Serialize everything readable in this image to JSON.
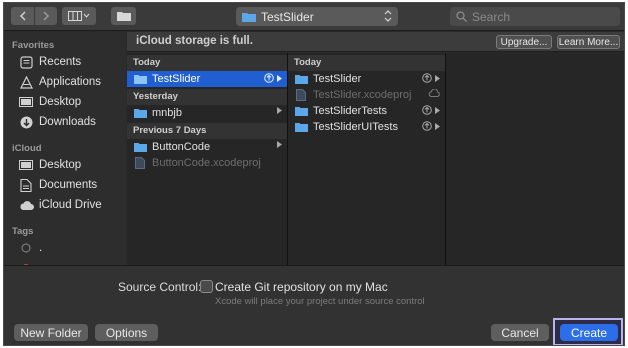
{
  "toolbar": {
    "back_icon": "chevron-left-icon",
    "forward_icon": "chevron-right-icon",
    "view_icon": "column-view-icon",
    "new_folder_icon": "folder-icon",
    "path_location": "TestSlider",
    "search_placeholder": "Search"
  },
  "sidebar": {
    "favorites_title": "Favorites",
    "favorites": [
      {
        "label": "Recents",
        "icon": "clock-icon"
      },
      {
        "label": "Applications",
        "icon": "applications-icon"
      },
      {
        "label": "Desktop",
        "icon": "desktop-icon"
      },
      {
        "label": "Downloads",
        "icon": "downloads-icon"
      }
    ],
    "icloud_title": "iCloud",
    "icloud": [
      {
        "label": "Desktop",
        "icon": "desktop-icon"
      },
      {
        "label": "Documents",
        "icon": "document-icon"
      },
      {
        "label": "iCloud Drive",
        "icon": "cloud-icon"
      }
    ],
    "tags_title": "Tags",
    "tags": [
      {
        "label": ".",
        "icon": "tag-dot-icon"
      }
    ]
  },
  "banner": {
    "message": "iCloud storage is full.",
    "upgrade_label": "Upgrade...",
    "learn_more_label": "Learn More..."
  },
  "column1": {
    "groups": [
      {
        "title": "Today",
        "items": [
          {
            "label": "TestSlider",
            "selected": true
          }
        ]
      },
      {
        "title": "Yesterday",
        "items": [
          {
            "label": "mnbjb",
            "selected": false
          }
        ]
      },
      {
        "title": "Previous 7 Days",
        "items": [
          {
            "label": "ButtonCode",
            "selected": false
          },
          {
            "label": "ButtonCode.xcodeproj",
            "selected": false
          }
        ]
      }
    ]
  },
  "column2": {
    "title": "Today",
    "items": [
      {
        "label": "TestSlider"
      },
      {
        "label": "TestSlider.xcodeproj"
      },
      {
        "label": "TestSliderTests"
      },
      {
        "label": "TestSliderUITests"
      }
    ]
  },
  "bottom": {
    "source_control_label": "Source Control:",
    "git_checkbox_label": "Create Git repository on my Mac",
    "git_checked": false,
    "hint": "Xcode will place your project under source control",
    "new_folder_label": "New Folder",
    "options_label": "Options",
    "cancel_label": "Cancel",
    "create_label": "Create"
  },
  "colors": {
    "selection": "#1f5fd1",
    "create_button": "#2b6ee8",
    "focus_outline": "#b9b3f0"
  }
}
